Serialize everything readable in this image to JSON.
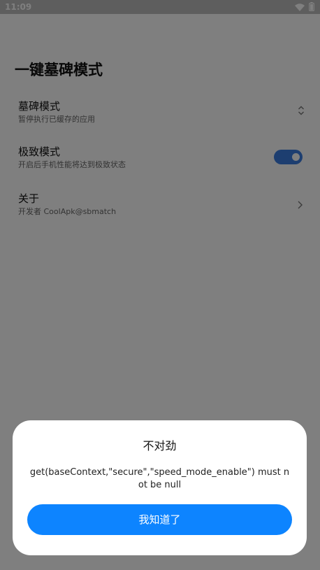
{
  "status_bar": {
    "time": "11:09",
    "icons": [
      "wifi-icon",
      "battery-icon"
    ]
  },
  "page": {
    "title": "一键墓碑模式"
  },
  "settings": [
    {
      "title": "墓碑模式",
      "subtitle": "暂停执行已缓存的应用",
      "control": "chevron-up-down-icon"
    },
    {
      "title": "极致模式",
      "subtitle": "开启后手机性能将达到极致状态",
      "control": "toggle",
      "toggle_on": true
    },
    {
      "title": "关于",
      "subtitle": "开发者 CoolApk@sbmatch",
      "control": "chevron-right-icon"
    }
  ],
  "dialog": {
    "title": "不对劲",
    "message": "get(baseContext,\"secure\",\"speed_mode_enable\") must not be null",
    "button_label": "我知道了"
  },
  "colors": {
    "accent": "#0d84ff",
    "toggle_on": "#3a7de0",
    "scrim": "rgba(0,0,0,0.5)"
  }
}
